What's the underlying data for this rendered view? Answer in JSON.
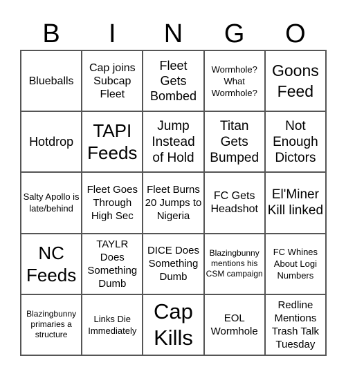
{
  "header": {
    "letters": [
      "B",
      "I",
      "N",
      "G",
      "O"
    ]
  },
  "cells": [
    [
      "Blueballs",
      "Cap joins Subcap Fleet",
      "Fleet Gets Bombed",
      "Wormhole? What Wormhole?",
      "Goons Feed"
    ],
    [
      "Hotdrop",
      "TAPI Feeds",
      "Jump Instead of Hold",
      "Titan Gets Bumped",
      "Not Enough Dictors"
    ],
    [
      "Salty Apollo is late/behind",
      "Fleet Goes Through High Sec",
      "Fleet Burns 20 Jumps to Nigeria",
      "FC Gets Headshot",
      "El'Miner Kill linked"
    ],
    [
      "NC Feeds",
      "TAYLR Does Something Dumb",
      "DICE Does Something Dumb",
      "Blazingbunny mentions his CSM campaign",
      "FC Whines About Logi Numbers"
    ],
    [
      "Blazingbunny primaries a structure",
      "Links Die Immediately",
      "Cap Kills",
      "EOL Wormhole",
      "Redline Mentions Trash Talk Tuesday"
    ]
  ]
}
